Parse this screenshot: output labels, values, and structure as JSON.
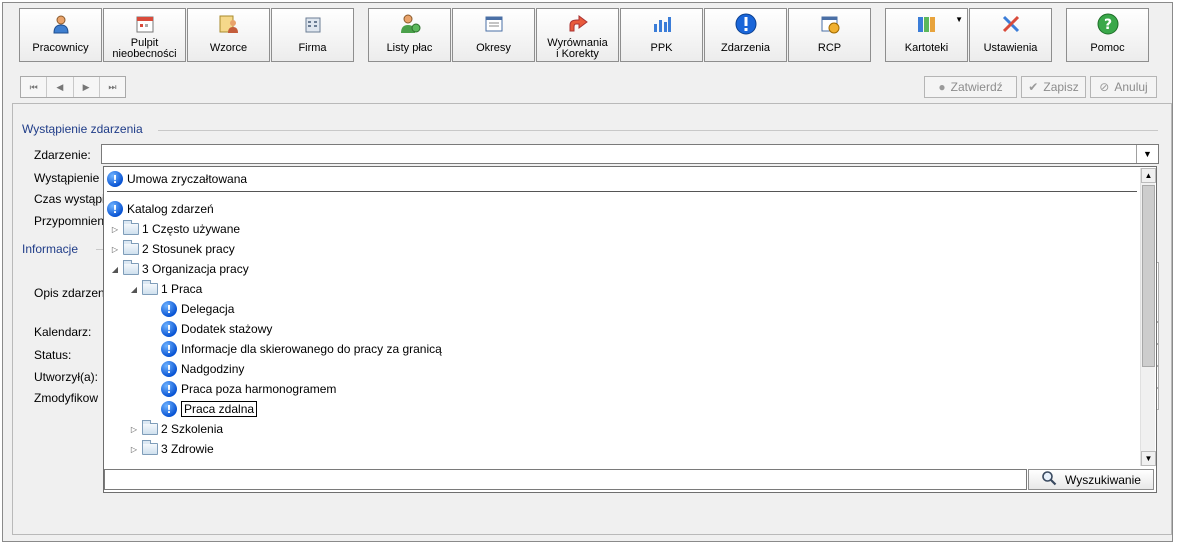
{
  "toolbar": {
    "buttons": [
      {
        "label": "Pracownicy",
        "icon": "person-icon"
      },
      {
        "label": "Pulpit\nnieobecności",
        "icon": "calendar-icon"
      },
      {
        "label": "Wzorce",
        "icon": "template-icon"
      },
      {
        "label": "Firma",
        "icon": "building-icon"
      },
      {
        "label": "Listy płac",
        "icon": "payroll-icon"
      },
      {
        "label": "Okresy",
        "icon": "period-icon"
      },
      {
        "label": "Wyrównania\ni Korekty",
        "icon": "arrow-redo-icon"
      },
      {
        "label": "PPK",
        "icon": "bar-chart-icon"
      },
      {
        "label": "Zdarzenia",
        "icon": "info-icon"
      },
      {
        "label": "RCP",
        "icon": "clock-calendar-icon"
      },
      {
        "label": "Kartoteki",
        "icon": "binders-icon"
      },
      {
        "label": "Ustawienia",
        "icon": "tools-icon"
      },
      {
        "label": "Pomoc",
        "icon": "help-icon"
      }
    ]
  },
  "nav": {
    "first": "⏮",
    "prev": "◀",
    "next": "▶",
    "last": "⏭"
  },
  "actions": {
    "confirm": "Zatwierdź",
    "save": "Zapisz",
    "cancel": "Anuluj"
  },
  "form": {
    "section_event": "Wystąpienie zdarzenia",
    "section_info": "Informacje",
    "labels": {
      "event": "Zdarzenie:",
      "occurrence": "Wystąpienie",
      "time": "Czas wystąpi",
      "reminder": "Przypomnien",
      "description": "Opis zdarzen",
      "calendar": "Kalendarz:",
      "status": "Status:",
      "created_by": "Utworzył(a):",
      "modified_by": "Zmodyfikow"
    },
    "event_value": ""
  },
  "dropdown": {
    "top_item": "Umowa zryczałtowana",
    "tree": [
      {
        "label": "Katalog zdarzeń",
        "kind": "event",
        "level": 0,
        "expander": ""
      },
      {
        "label": "1 Często używane",
        "kind": "folder",
        "level": 1,
        "expander": "▷"
      },
      {
        "label": "2 Stosunek pracy",
        "kind": "folder",
        "level": 1,
        "expander": "▷"
      },
      {
        "label": "3 Organizacja pracy",
        "kind": "folder",
        "level": 1,
        "expander": "◢"
      },
      {
        "label": "1 Praca",
        "kind": "folder",
        "level": 2,
        "expander": "◢"
      },
      {
        "label": "Delegacja",
        "kind": "event",
        "level": 3,
        "expander": ""
      },
      {
        "label": "Dodatek stażowy",
        "kind": "event",
        "level": 3,
        "expander": ""
      },
      {
        "label": "Informacje dla skierowanego do pracy za granicą",
        "kind": "event",
        "level": 3,
        "expander": ""
      },
      {
        "label": "Nadgodziny",
        "kind": "event",
        "level": 3,
        "expander": ""
      },
      {
        "label": "Praca poza harmonogramem",
        "kind": "event",
        "level": 3,
        "expander": ""
      },
      {
        "label": "Praca zdalna",
        "kind": "event",
        "level": 3,
        "expander": "",
        "selected": true
      },
      {
        "label": "2 Szkolenia",
        "kind": "folder",
        "level": 2,
        "expander": "▷"
      },
      {
        "label": "3 Zdrowie",
        "kind": "folder",
        "level": 2,
        "expander": "▷"
      }
    ],
    "search_value": "",
    "search_button": "Wyszukiwanie"
  },
  "colors": {
    "section_title": "#1f3c88",
    "info_icon": "#0a55d4",
    "window_bg": "#f0f0f0"
  }
}
